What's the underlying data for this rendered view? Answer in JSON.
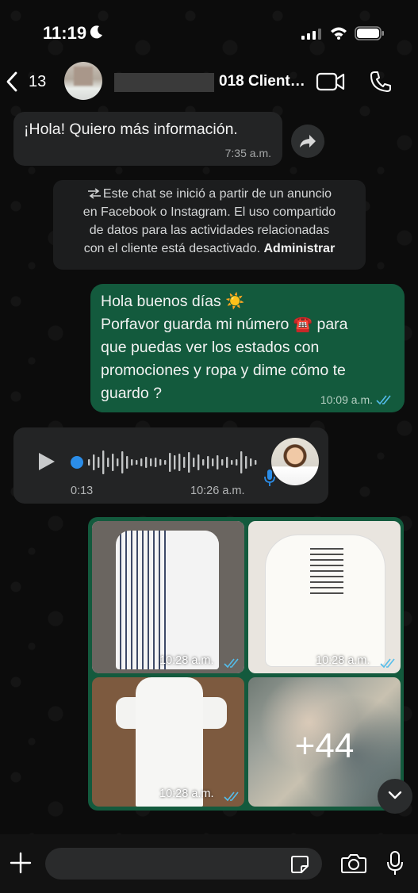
{
  "status_bar": {
    "time": "11:19"
  },
  "header": {
    "back_count": "13",
    "contact_name": "018 Client…"
  },
  "messages": {
    "m1": {
      "text": "¡Hola! Quiero más información.",
      "time": "7:35 a.m."
    },
    "system": {
      "line1": "Este chat se inició a partir de un anuncio",
      "line2": "en Facebook o Instagram. El uso compartido",
      "line3": "de datos para las actividades relacionadas",
      "line4": "con el cliente está desactivado.",
      "link": "Administrar"
    },
    "m2": {
      "line1": "Hola buenos días ☀️",
      "line2": "Porfavor guarda mi número ☎️ para",
      "line3": "que puedas ver los estados con",
      "line4": "promociones y ropa y dime cómo te",
      "line5": "guardo ?",
      "time": "10:09 a.m."
    },
    "voice": {
      "duration": "0:13",
      "time": "10:26 a.m."
    },
    "album": {
      "photo_times": [
        "10:28 a.m.",
        "10:28 a.m.",
        "10:28 a.m."
      ],
      "more_count": "+44"
    }
  },
  "colors": {
    "outgoing_bubble": "#135a3d",
    "incoming_bubble": "#232425",
    "read_ticks": "#53bdeb",
    "accent": "#2b8de8"
  },
  "icons": [
    "moon-icon",
    "signal-icon",
    "wifi-icon",
    "battery-icon",
    "back-chevron-icon",
    "video-call-icon",
    "phone-call-icon",
    "forward-icon",
    "play-icon",
    "mic-icon",
    "chevron-down-icon",
    "plus-icon",
    "sticker-icon",
    "camera-icon"
  ]
}
